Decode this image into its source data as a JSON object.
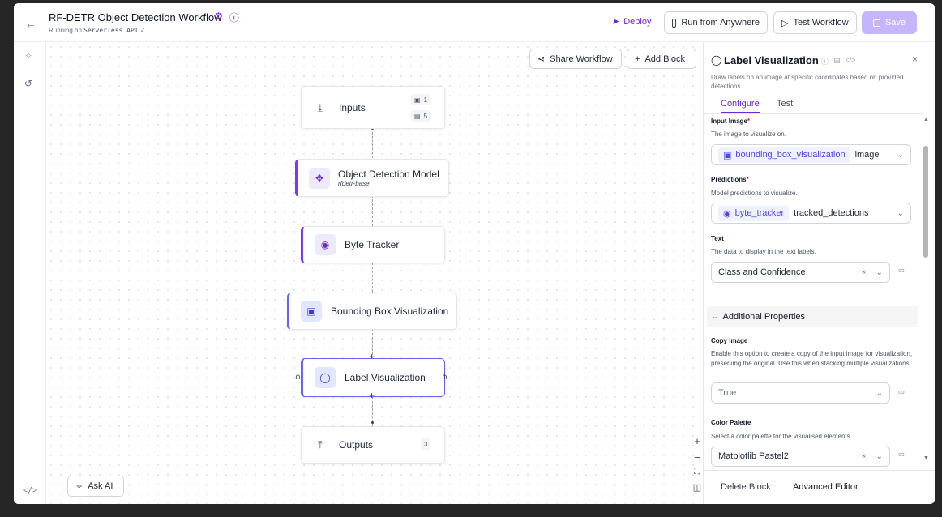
{
  "header": {
    "title": "RF-DETR Object Detection Workflow",
    "subtitle_prefix": "Running on",
    "subtitle_target": "Serverless API",
    "deploy_label": "Deploy",
    "run_anywhere_label": "Run from Anywhere",
    "test_label": "Test Workflow",
    "save_label": "Save"
  },
  "canvas": {
    "share_label": "Share Workflow",
    "add_block_label": "Add Block",
    "ask_ai_label": "Ask AI",
    "nodes": {
      "inputs": {
        "label": "Inputs",
        "image_count": "1",
        "param_count": "5"
      },
      "object_detection": {
        "label": "Object Detection Model",
        "sub": "rfdetr-base"
      },
      "byte_tracker": {
        "label": "Byte Tracker"
      },
      "bbox_vis": {
        "label": "Bounding Box Visualization"
      },
      "label_vis": {
        "label": "Label Visualization"
      },
      "outputs": {
        "label": "Outputs",
        "count": "3"
      }
    }
  },
  "panel": {
    "title": "Label Visualization",
    "description": "Draw labels on an image at specific coordinates based on provided detections.",
    "tabs": [
      "Configure",
      "Test"
    ],
    "input_image": {
      "label": "Input Image",
      "hint": "The image to visualize on.",
      "chip": "bounding_box_visualization",
      "value": "image"
    },
    "predictions": {
      "label": "Predictions",
      "hint": "Model predictions to visualize.",
      "chip": "byte_tracker",
      "value": "tracked_detections"
    },
    "text": {
      "label": "Text",
      "hint": "The data to display in the text labels.",
      "value": "Class and Confidence"
    },
    "additional_label": "Additional Properties",
    "copy_image": {
      "label": "Copy Image",
      "hint": "Enable this option to create a copy of the input image for visualization, preserving the original. Use this when stacking multiple visualizations.",
      "value": "True"
    },
    "color_palette": {
      "label": "Color Palette",
      "hint": "Select a color palette for the visualised elements.",
      "value": "Matplotlib Pastel2"
    },
    "delete_label": "Delete Block",
    "advanced_label": "Advanced Editor"
  },
  "colors": {
    "accent": "#7c3aed",
    "selected_border": "#6366f1"
  }
}
